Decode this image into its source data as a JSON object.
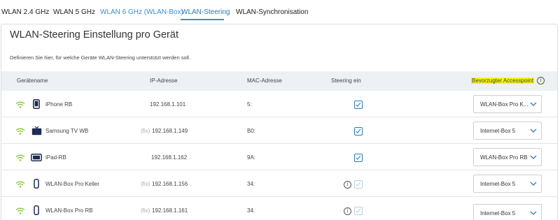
{
  "tabs": [
    {
      "label": "WLAN 2.4 GHz"
    },
    {
      "label": "WLAN 5 GHz"
    },
    {
      "label": "WLAN 6 GHz (WLAN-Box)"
    },
    {
      "label": "WLAN-Steering"
    },
    {
      "label": "WLAN-Synchronisation"
    }
  ],
  "page": {
    "title": "WLAN-Steering Einstellung pro Gerät",
    "description": "Definieren Sie hier, für welche Geräte WLAN-Steering unterstützt werden soll."
  },
  "table": {
    "headers": {
      "device": "Gerätename",
      "ip": "IP-Adresse",
      "mac": "MAC-Adresse",
      "steering": "Steering ein",
      "preferred": "Bevorzugter Accesspoint"
    },
    "info_symbol": "i",
    "fix_label": "(fix)",
    "rows": [
      {
        "name": "iPhone RB",
        "ip": "192.168.1.101",
        "mac": "5:",
        "steering": "checked",
        "preferred": "WLAN-Box Pro K...",
        "icon": "phone-icon"
      },
      {
        "name": "Samsung TV WB",
        "ip": "192.168.1.149",
        "mac": "B0:",
        "steering": "checked",
        "preferred": "Internet-Box 5",
        "icon": "tv-icon"
      },
      {
        "name": "iPad-RB",
        "ip": "192.168.1.162",
        "mac": "9A:",
        "steering": "checked",
        "preferred": "WLAN-Box Pro RB",
        "icon": "tablet-icon"
      },
      {
        "name": "WLAN-Box Pro Keller",
        "ip": "192.168.1.156",
        "mac": "34:",
        "steering": "disabled",
        "preferred": "Internet-Box 5",
        "icon": "wlan-box-icon"
      },
      {
        "name": "WLAN-Box Pro RB",
        "ip": "192.168.1.161",
        "mac": "34:",
        "steering": "disabled",
        "preferred": "Internet-Box 5",
        "icon": "wlan-box-icon"
      }
    ]
  },
  "colors": {
    "accent": "#2a7ab8",
    "link": "#3a90c8",
    "wifi_green": "#8cc63f",
    "highlight": "#f6f316"
  }
}
